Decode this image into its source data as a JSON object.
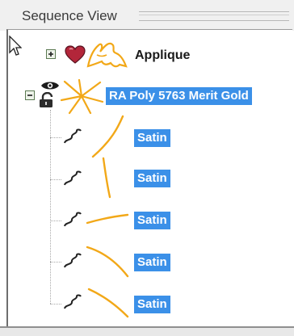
{
  "panel": {
    "title": "Sequence View"
  },
  "tree": {
    "applique": {
      "label": "Applique"
    },
    "thread": {
      "label": "RA Poly 5763 Merit Gold"
    },
    "stitches": [
      {
        "label": "Satin"
      },
      {
        "label": "Satin"
      },
      {
        "label": "Satin"
      },
      {
        "label": "Satin"
      },
      {
        "label": "Satin"
      }
    ]
  },
  "icons": {
    "expand": "plus-icon",
    "collapse": "minus-icon",
    "heart": "heart-icon",
    "visible": "eye-icon",
    "lock": "lock-icon",
    "stitch": "stitch-icon",
    "cursor": "pointer-icon"
  },
  "colors": {
    "selection": "#3b90e8",
    "thread": "#f2a818",
    "heart": "#b3263a"
  }
}
